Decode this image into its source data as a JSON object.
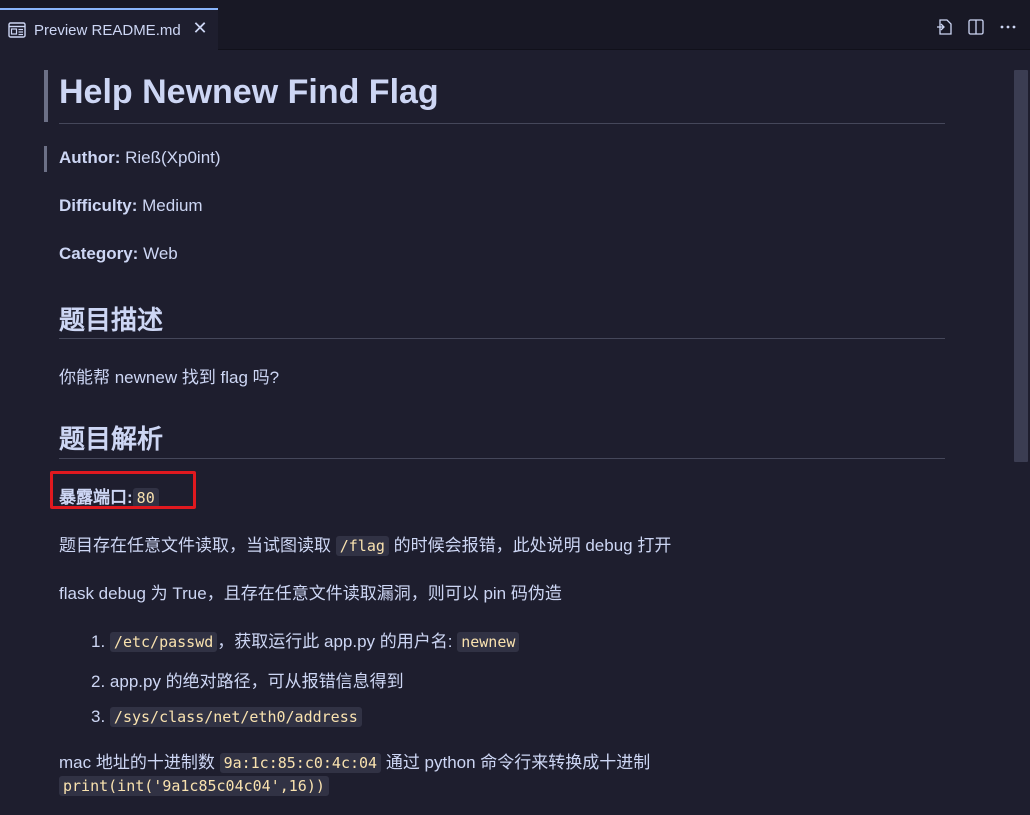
{
  "tab": {
    "label": "Preview README.md",
    "icon": "preview-icon",
    "close_icon": "close-icon"
  },
  "actions": [
    {
      "name": "open-source-icon"
    },
    {
      "name": "split-editor-icon"
    },
    {
      "name": "more-actions-icon"
    }
  ],
  "doc": {
    "title": "Help Newnew Find Flag",
    "author_label": "Author:",
    "author_value": "Rieß(Xp0int)",
    "difficulty_label": "Difficulty:",
    "difficulty_value": "Medium",
    "category_label": "Category:",
    "category_value": "Web",
    "section1_title": "题目描述",
    "section1_text": "你能帮 newnew 找到 flag 吗?",
    "section2_title": "题目解析",
    "port_label": "暴露端口:",
    "port_value": "80",
    "p1_before": "题目存在任意文件读取，当试图读取 ",
    "p1_code": "/flag",
    "p1_after": " 的时候会报错，此处说明 debug 打开",
    "p2": "flask debug 为 True，且存在任意文件读取漏洞，则可以 pin 码伪造",
    "li1_num": "1.",
    "li1_code": "/etc/passwd",
    "li1_text": "，获取运行此 app.py 的用户名: ",
    "li1_code2": "newnew",
    "li2_num": "2.",
    "li2_text": "app.py 的绝对路径，可从报错信息得到",
    "li3_num": "3.",
    "li3_code": "/sys/class/net/eth0/address",
    "p3_before": "mac 地址的十进制数 ",
    "p3_code": "9a:1c:85:c0:4c:04",
    "p3_after": " 通过 python 命令行来转换成十进制",
    "p4_code": "print(int('9a1c85c04c04',16))"
  }
}
